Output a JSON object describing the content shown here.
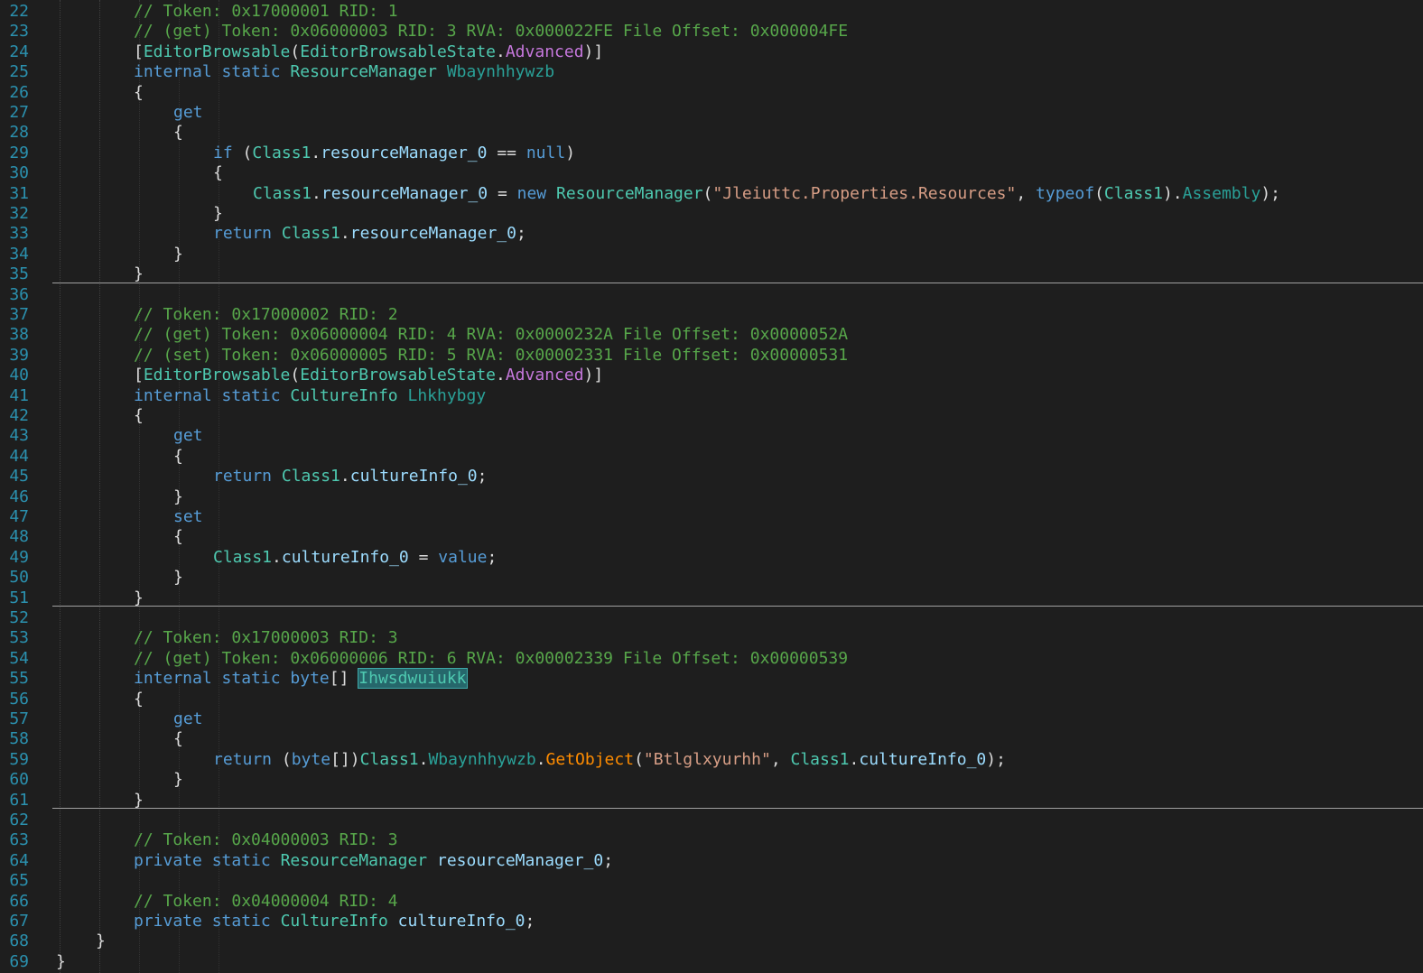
{
  "editor": {
    "colors": {
      "background": "#1e1e1e",
      "line_number": "#2b91af",
      "comment": "#57a64a",
      "keyword": "#569cd6",
      "type": "#4ec9b0",
      "string": "#d69d85",
      "method": "#ff8c00",
      "enum_member": "#c678dd"
    },
    "lines": [
      {
        "n": "22",
        "indent": 2,
        "tokens": [
          [
            "c-comment",
            "// Token: 0x17000001 RID: 1"
          ]
        ]
      },
      {
        "n": "23",
        "indent": 2,
        "tokens": [
          [
            "c-comment",
            "// (get) Token: 0x06000003 RID: 3 RVA: 0x000022FE File Offset: 0x000004FE"
          ]
        ]
      },
      {
        "n": "24",
        "indent": 2,
        "tokens": [
          [
            "c-punct",
            "["
          ],
          [
            "c-type",
            "EditorBrowsable"
          ],
          [
            "c-punct",
            "("
          ],
          [
            "c-type",
            "EditorBrowsableState"
          ],
          [
            "c-punct",
            "."
          ],
          [
            "c-enumval",
            "Advanced"
          ],
          [
            "c-punct",
            ")]"
          ]
        ]
      },
      {
        "n": "25",
        "indent": 2,
        "tokens": [
          [
            "c-keyword",
            "internal"
          ],
          [
            "c-punct",
            " "
          ],
          [
            "c-keyword",
            "static"
          ],
          [
            "c-punct",
            " "
          ],
          [
            "c-type",
            "ResourceManager"
          ],
          [
            "c-punct",
            " "
          ],
          [
            "c-prop",
            "Wbaynhhywzb"
          ]
        ]
      },
      {
        "n": "26",
        "indent": 2,
        "tokens": [
          [
            "c-punct",
            "{"
          ]
        ]
      },
      {
        "n": "27",
        "indent": 3,
        "tokens": [
          [
            "c-keyword",
            "get"
          ]
        ]
      },
      {
        "n": "28",
        "indent": 3,
        "tokens": [
          [
            "c-punct",
            "{"
          ]
        ]
      },
      {
        "n": "29",
        "indent": 4,
        "tokens": [
          [
            "c-keyword",
            "if"
          ],
          [
            "c-punct",
            " ("
          ],
          [
            "c-type",
            "Class1"
          ],
          [
            "c-punct",
            "."
          ],
          [
            "c-field",
            "resourceManager_0"
          ],
          [
            "c-punct",
            " == "
          ],
          [
            "c-keyword",
            "null"
          ],
          [
            "c-punct",
            ")"
          ]
        ]
      },
      {
        "n": "30",
        "indent": 4,
        "tokens": [
          [
            "c-punct",
            "{"
          ]
        ]
      },
      {
        "n": "31",
        "indent": 5,
        "tokens": [
          [
            "c-type",
            "Class1"
          ],
          [
            "c-punct",
            "."
          ],
          [
            "c-field",
            "resourceManager_0"
          ],
          [
            "c-punct",
            " = "
          ],
          [
            "c-keyword",
            "new"
          ],
          [
            "c-punct",
            " "
          ],
          [
            "c-type",
            "ResourceManager"
          ],
          [
            "c-punct",
            "("
          ],
          [
            "c-string",
            "\"Jleiuttc.Properties.Resources\""
          ],
          [
            "c-punct",
            ", "
          ],
          [
            "c-keyword",
            "typeof"
          ],
          [
            "c-punct",
            "("
          ],
          [
            "c-type",
            "Class1"
          ],
          [
            "c-punct",
            ")."
          ],
          [
            "c-prop",
            "Assembly"
          ],
          [
            "c-punct",
            ");"
          ]
        ]
      },
      {
        "n": "32",
        "indent": 4,
        "tokens": [
          [
            "c-punct",
            "}"
          ]
        ]
      },
      {
        "n": "33",
        "indent": 4,
        "tokens": [
          [
            "c-keyword",
            "return"
          ],
          [
            "c-punct",
            " "
          ],
          [
            "c-type",
            "Class1"
          ],
          [
            "c-punct",
            "."
          ],
          [
            "c-field",
            "resourceManager_0"
          ],
          [
            "c-punct",
            ";"
          ]
        ]
      },
      {
        "n": "34",
        "indent": 3,
        "tokens": [
          [
            "c-punct",
            "}"
          ]
        ]
      },
      {
        "n": "35",
        "indent": 2,
        "tokens": [
          [
            "c-punct",
            "}"
          ]
        ]
      },
      {
        "n": "36",
        "indent": 0,
        "sep": true,
        "tokens": []
      },
      {
        "n": "37",
        "indent": 2,
        "tokens": [
          [
            "c-comment",
            "// Token: 0x17000002 RID: 2"
          ]
        ]
      },
      {
        "n": "38",
        "indent": 2,
        "tokens": [
          [
            "c-comment",
            "// (get) Token: 0x06000004 RID: 4 RVA: 0x0000232A File Offset: 0x0000052A"
          ]
        ]
      },
      {
        "n": "39",
        "indent": 2,
        "tokens": [
          [
            "c-comment",
            "// (set) Token: 0x06000005 RID: 5 RVA: 0x00002331 File Offset: 0x00000531"
          ]
        ]
      },
      {
        "n": "40",
        "indent": 2,
        "tokens": [
          [
            "c-punct",
            "["
          ],
          [
            "c-type",
            "EditorBrowsable"
          ],
          [
            "c-punct",
            "("
          ],
          [
            "c-type",
            "EditorBrowsableState"
          ],
          [
            "c-punct",
            "."
          ],
          [
            "c-enumval",
            "Advanced"
          ],
          [
            "c-punct",
            ")]"
          ]
        ]
      },
      {
        "n": "41",
        "indent": 2,
        "tokens": [
          [
            "c-keyword",
            "internal"
          ],
          [
            "c-punct",
            " "
          ],
          [
            "c-keyword",
            "static"
          ],
          [
            "c-punct",
            " "
          ],
          [
            "c-type",
            "CultureInfo"
          ],
          [
            "c-punct",
            " "
          ],
          [
            "c-prop",
            "Lhkhybgy"
          ]
        ]
      },
      {
        "n": "42",
        "indent": 2,
        "tokens": [
          [
            "c-punct",
            "{"
          ]
        ]
      },
      {
        "n": "43",
        "indent": 3,
        "tokens": [
          [
            "c-keyword",
            "get"
          ]
        ]
      },
      {
        "n": "44",
        "indent": 3,
        "tokens": [
          [
            "c-punct",
            "{"
          ]
        ]
      },
      {
        "n": "45",
        "indent": 4,
        "tokens": [
          [
            "c-keyword",
            "return"
          ],
          [
            "c-punct",
            " "
          ],
          [
            "c-type",
            "Class1"
          ],
          [
            "c-punct",
            "."
          ],
          [
            "c-field",
            "cultureInfo_0"
          ],
          [
            "c-punct",
            ";"
          ]
        ]
      },
      {
        "n": "46",
        "indent": 3,
        "tokens": [
          [
            "c-punct",
            "}"
          ]
        ]
      },
      {
        "n": "47",
        "indent": 3,
        "tokens": [
          [
            "c-keyword",
            "set"
          ]
        ]
      },
      {
        "n": "48",
        "indent": 3,
        "tokens": [
          [
            "c-punct",
            "{"
          ]
        ]
      },
      {
        "n": "49",
        "indent": 4,
        "tokens": [
          [
            "c-type",
            "Class1"
          ],
          [
            "c-punct",
            "."
          ],
          [
            "c-field",
            "cultureInfo_0"
          ],
          [
            "c-punct",
            " = "
          ],
          [
            "c-keyword",
            "value"
          ],
          [
            "c-punct",
            ";"
          ]
        ]
      },
      {
        "n": "50",
        "indent": 3,
        "tokens": [
          [
            "c-punct",
            "}"
          ]
        ]
      },
      {
        "n": "51",
        "indent": 2,
        "tokens": [
          [
            "c-punct",
            "}"
          ]
        ]
      },
      {
        "n": "52",
        "indent": 0,
        "sep": true,
        "tokens": []
      },
      {
        "n": "53",
        "indent": 2,
        "tokens": [
          [
            "c-comment",
            "// Token: 0x17000003 RID: 3"
          ]
        ]
      },
      {
        "n": "54",
        "indent": 2,
        "tokens": [
          [
            "c-comment",
            "// (get) Token: 0x06000006 RID: 6 RVA: 0x00002339 File Offset: 0x00000539"
          ]
        ]
      },
      {
        "n": "55",
        "indent": 2,
        "tokens": [
          [
            "c-keyword",
            "internal"
          ],
          [
            "c-punct",
            " "
          ],
          [
            "c-keyword",
            "static"
          ],
          [
            "c-punct",
            " "
          ],
          [
            "c-keyword",
            "byte"
          ],
          [
            "c-punct",
            "[] "
          ],
          [
            "hl",
            "Ihwsdwuiukk"
          ]
        ]
      },
      {
        "n": "56",
        "indent": 2,
        "tokens": [
          [
            "c-punct",
            "{"
          ]
        ]
      },
      {
        "n": "57",
        "indent": 3,
        "tokens": [
          [
            "c-keyword",
            "get"
          ]
        ]
      },
      {
        "n": "58",
        "indent": 3,
        "tokens": [
          [
            "c-punct",
            "{"
          ]
        ]
      },
      {
        "n": "59",
        "indent": 4,
        "tokens": [
          [
            "c-keyword",
            "return"
          ],
          [
            "c-punct",
            " ("
          ],
          [
            "c-keyword",
            "byte"
          ],
          [
            "c-punct",
            "[])"
          ],
          [
            "c-type",
            "Class1"
          ],
          [
            "c-punct",
            "."
          ],
          [
            "c-prop",
            "Wbaynhhywzb"
          ],
          [
            "c-punct",
            "."
          ],
          [
            "c-method",
            "GetObject"
          ],
          [
            "c-punct",
            "("
          ],
          [
            "c-string",
            "\"Btlglxyurhh\""
          ],
          [
            "c-punct",
            ", "
          ],
          [
            "c-type",
            "Class1"
          ],
          [
            "c-punct",
            "."
          ],
          [
            "c-field",
            "cultureInfo_0"
          ],
          [
            "c-punct",
            ");"
          ]
        ]
      },
      {
        "n": "60",
        "indent": 3,
        "tokens": [
          [
            "c-punct",
            "}"
          ]
        ]
      },
      {
        "n": "61",
        "indent": 2,
        "tokens": [
          [
            "c-punct",
            "}"
          ]
        ]
      },
      {
        "n": "62",
        "indent": 0,
        "sep": true,
        "tokens": []
      },
      {
        "n": "63",
        "indent": 2,
        "tokens": [
          [
            "c-comment",
            "// Token: 0x04000003 RID: 3"
          ]
        ]
      },
      {
        "n": "64",
        "indent": 2,
        "tokens": [
          [
            "c-keyword",
            "private"
          ],
          [
            "c-punct",
            " "
          ],
          [
            "c-keyword",
            "static"
          ],
          [
            "c-punct",
            " "
          ],
          [
            "c-type",
            "ResourceManager"
          ],
          [
            "c-punct",
            " "
          ],
          [
            "c-field",
            "resourceManager_0"
          ],
          [
            "c-punct",
            ";"
          ]
        ]
      },
      {
        "n": "65",
        "indent": 0,
        "tokens": []
      },
      {
        "n": "66",
        "indent": 2,
        "tokens": [
          [
            "c-comment",
            "// Token: 0x04000004 RID: 4"
          ]
        ]
      },
      {
        "n": "67",
        "indent": 2,
        "tokens": [
          [
            "c-keyword",
            "private"
          ],
          [
            "c-punct",
            " "
          ],
          [
            "c-keyword",
            "static"
          ],
          [
            "c-punct",
            " "
          ],
          [
            "c-type",
            "CultureInfo"
          ],
          [
            "c-punct",
            " "
          ],
          [
            "c-field",
            "cultureInfo_0"
          ],
          [
            "c-punct",
            ";"
          ]
        ]
      },
      {
        "n": "68",
        "indent": 1,
        "tokens": [
          [
            "c-punct",
            "}"
          ]
        ]
      },
      {
        "n": "69",
        "indent": 0,
        "tokens": [
          [
            "c-punct",
            "}"
          ]
        ]
      }
    ]
  }
}
